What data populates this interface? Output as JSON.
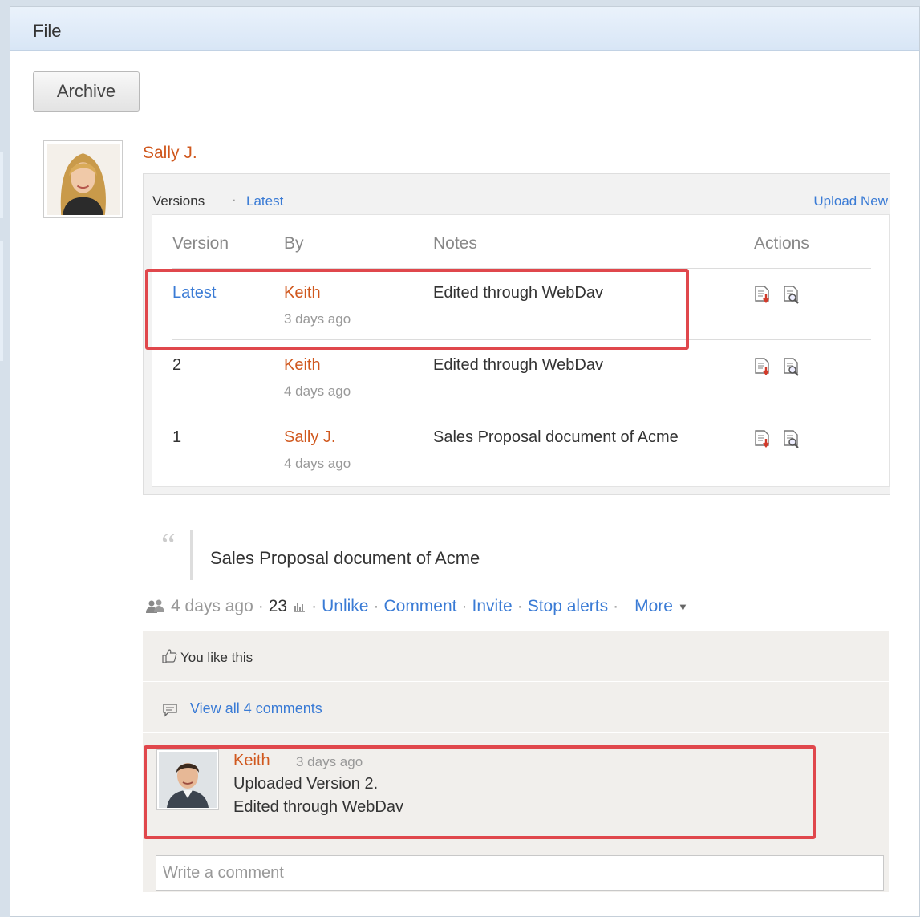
{
  "window": {
    "title": "File"
  },
  "toolbar": {
    "archive_label": "Archive"
  },
  "post": {
    "author": "Sally J.",
    "quote": "Sales Proposal document of Acme",
    "meta": {
      "time": "4 days ago",
      "sep": "·",
      "views": "23",
      "actions": [
        "Unlike",
        "Comment",
        "Invite",
        "Stop alerts",
        "More"
      ]
    }
  },
  "versions": {
    "label": "Versions",
    "latest_link": "Latest",
    "upload_new": "Upload New",
    "columns": [
      "Version",
      "By",
      "Notes",
      "Actions"
    ],
    "rows": [
      {
        "version": "Latest",
        "by": "Keith",
        "time": "3 days ago",
        "notes": "Edited through WebDav"
      },
      {
        "version": "2",
        "by": "Keith",
        "time": "4 days ago",
        "notes": "Edited through WebDav"
      },
      {
        "version": "1",
        "by": "Sally J.",
        "time": "4 days ago",
        "notes": "Sales Proposal document of Acme"
      }
    ]
  },
  "feedback": {
    "likes": "You like this",
    "view_comments": "View all 4 comments"
  },
  "comment": {
    "author": "Keith",
    "time": "3 days ago",
    "line1": "Uploaded Version 2.",
    "line2": "Edited through WebDav"
  },
  "comment_input": {
    "placeholder": "Write a comment"
  },
  "icons": {
    "download": "download-doc-icon",
    "preview": "preview-doc-icon",
    "people": "people-icon",
    "stats": "stats-icon",
    "like": "thumbs-up-icon",
    "comment": "speech-bubble-icon"
  },
  "colors": {
    "link": "#3a7bd5",
    "author": "#d0581e",
    "highlight": "#e0474c",
    "titlebar": "#dce8f6"
  }
}
